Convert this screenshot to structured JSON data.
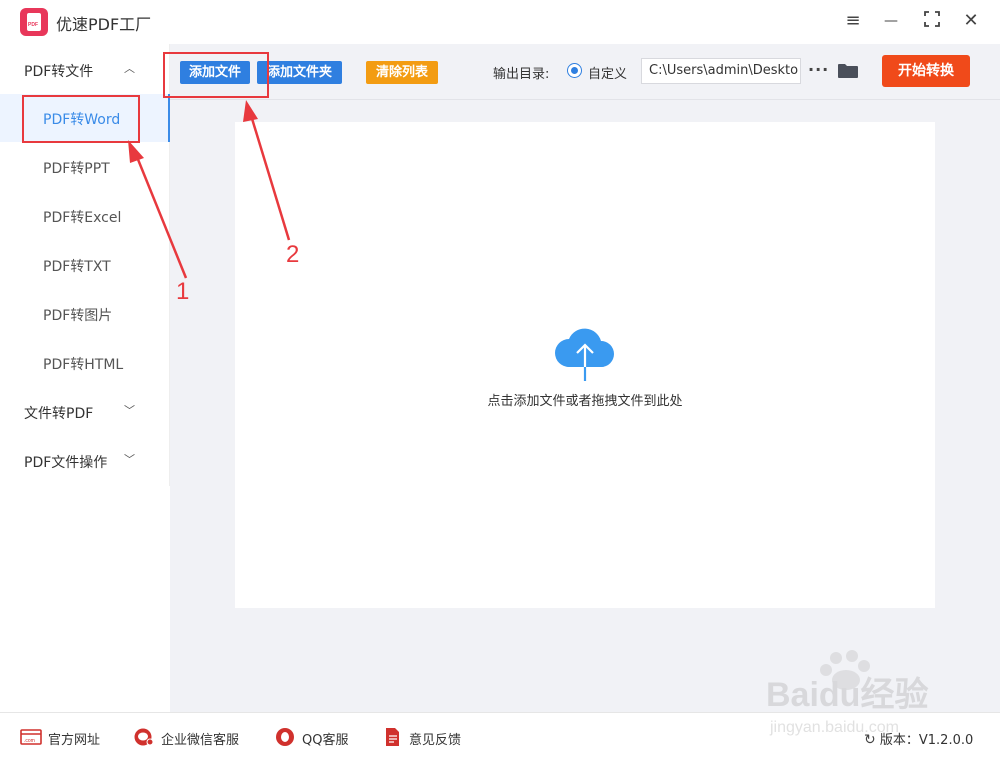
{
  "app": {
    "title": "优速PDF工厂",
    "logo_text": "PDF"
  },
  "window_controls": {
    "menu": "≡",
    "minimize": "—",
    "maximize": "⛶",
    "close": "✕"
  },
  "sidebar": {
    "groups": [
      {
        "label": "PDF转文件",
        "expanded": true,
        "items": [
          {
            "label": "PDF转Word",
            "active": true
          },
          {
            "label": "PDF转PPT"
          },
          {
            "label": "PDF转Excel"
          },
          {
            "label": "PDF转TXT"
          },
          {
            "label": "PDF转图片"
          },
          {
            "label": "PDF转HTML"
          }
        ]
      },
      {
        "label": "文件转PDF",
        "expanded": false
      },
      {
        "label": "PDF文件操作",
        "expanded": false
      }
    ]
  },
  "toolbar": {
    "add_file": "添加文件",
    "add_folder": "添加文件夹",
    "clear_list": "清除列表",
    "output_label": "输出目录:",
    "custom_label": "自定义",
    "path_value": "C:\\Users\\admin\\Deskto",
    "more": "···",
    "start": "开始转换",
    "colors": {
      "primary": "#2f7fe0",
      "clear": "#f39c12",
      "start": "#f04a1a"
    }
  },
  "dropzone": {
    "hint": "点击添加文件或者拖拽文件到此处",
    "icon": "cloud-upload-icon",
    "icon_color": "#3a9af0"
  },
  "footer": {
    "links": [
      {
        "label": "官方网址",
        "icon": "website-icon"
      },
      {
        "label": "企业微信客服",
        "icon": "wechat-work-icon"
      },
      {
        "label": "QQ客服",
        "icon": "qq-icon"
      },
      {
        "label": "意见反馈",
        "icon": "feedback-icon"
      }
    ],
    "version": "版本：V1.2.0.0"
  },
  "annotations": {
    "label_1": "1",
    "label_2": "2",
    "color": "#e8393e"
  },
  "watermark": {
    "text": "Baidu经验",
    "url": "jingyan.baidu.com"
  }
}
